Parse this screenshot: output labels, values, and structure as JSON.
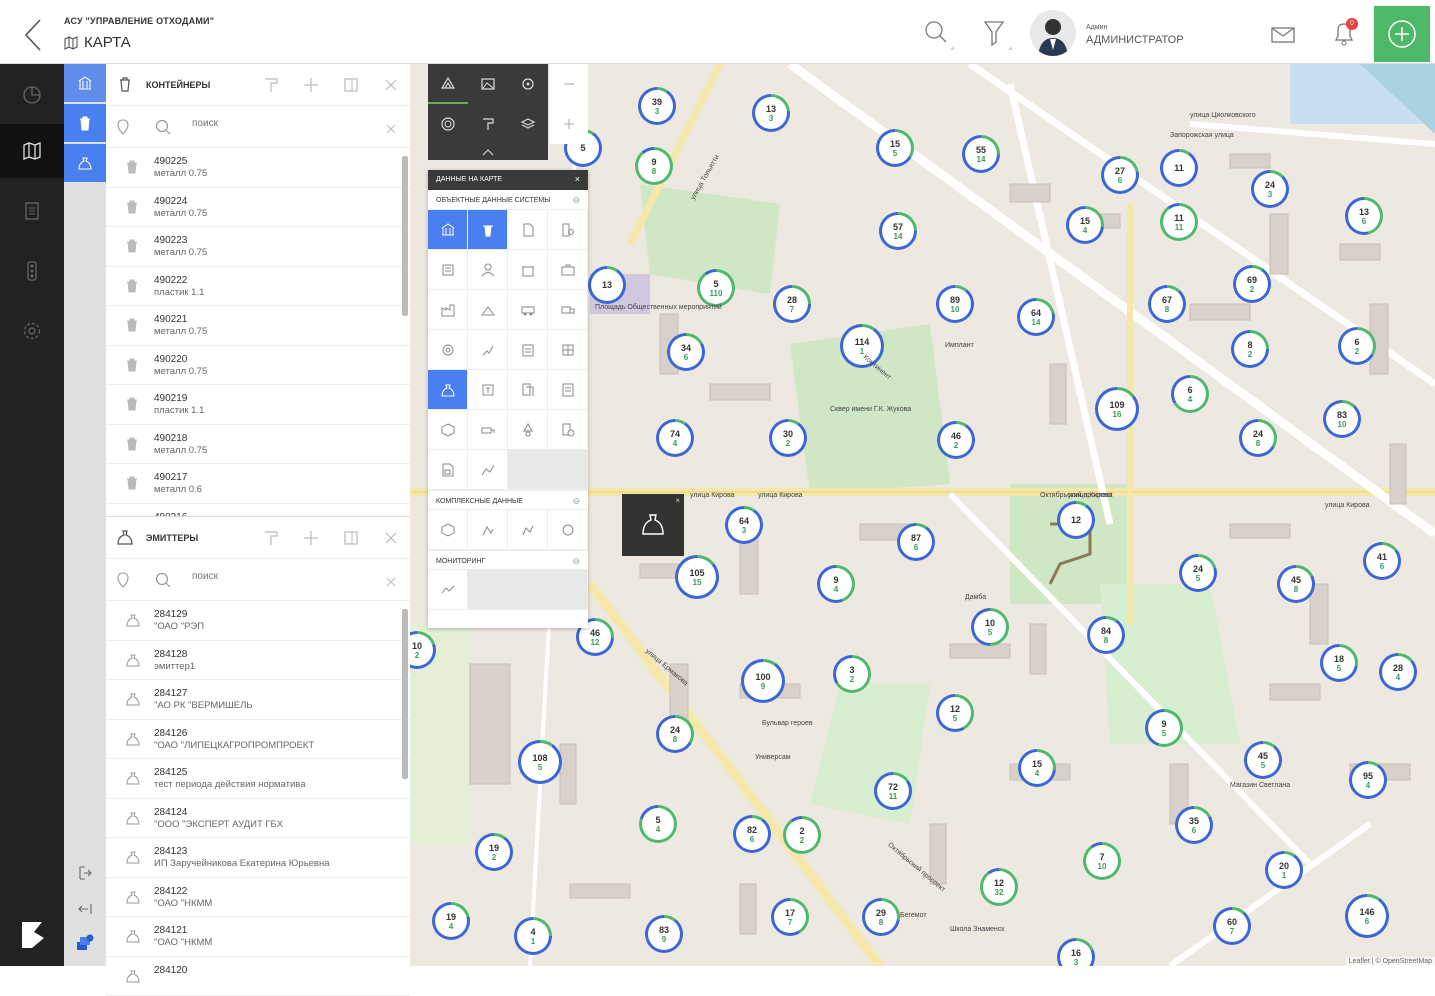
{
  "header": {
    "app_name": "АСУ \"УПРАВЛЕНИЕ ОТХОДАМИ\"",
    "page_title": "КАРТА",
    "user_small": "Админ",
    "user_role": "АДМИНИСТРАТОР",
    "notifications": "0"
  },
  "containers": {
    "title": "КОНТЕЙНЕРЫ",
    "search_placeholder": "поиск",
    "items": [
      {
        "id": "490225",
        "desc": "металл 0.75"
      },
      {
        "id": "490224",
        "desc": "металл 0.75"
      },
      {
        "id": "490223",
        "desc": "металл 0.75"
      },
      {
        "id": "490222",
        "desc": "пластик 1.1"
      },
      {
        "id": "490221",
        "desc": "металл 0.75"
      },
      {
        "id": "490220",
        "desc": "металл 0.75"
      },
      {
        "id": "490219",
        "desc": "пластик 1.1"
      },
      {
        "id": "490218",
        "desc": "металл 0.75"
      },
      {
        "id": "490217",
        "desc": "металл 0.6"
      },
      {
        "id": "490216",
        "desc": ""
      }
    ]
  },
  "emitters": {
    "title": "ЭМИТТЕРЫ",
    "search_placeholder": "поиск",
    "items": [
      {
        "id": "284129",
        "desc": "\"ОАО \"РЭП"
      },
      {
        "id": "284128",
        "desc": "эмиттер1"
      },
      {
        "id": "284127",
        "desc": "\"АО РК \"ВЕРМИШЕЛЬ"
      },
      {
        "id": "284126",
        "desc": "\"ОАО \"ЛИПЕЦКАГРОПРОМПРОЕКТ"
      },
      {
        "id": "284125",
        "desc": "тест периода действия норматива"
      },
      {
        "id": "284124",
        "desc": "\"ООО \"ЭКСПЕРТ АУДИТ ГБХ"
      },
      {
        "id": "284123",
        "desc": "ИП Заручейникова Екатерина Юрьевна"
      },
      {
        "id": "284122",
        "desc": "\"ОАО \"НКММ"
      },
      {
        "id": "284121",
        "desc": "\"ОАО \"НКММ"
      },
      {
        "id": "284120",
        "desc": ""
      }
    ]
  },
  "layers": {
    "title": "ДАННЫЕ НА КАРТЕ",
    "section_objects": "ОБЪЕКТНЫЕ ДАННЫЕ СИСТЕМЫ",
    "section_complex": "КОМПЛЕКСНЫЕ ДАННЫЕ",
    "section_monitoring": "МОНИТОРИНГ"
  },
  "map": {
    "labels": [
      "улица Тольятти",
      "Запорожская улица",
      "Площадь Общественных мероприятий",
      "Сквер имени Г.К. Жукова",
      "улица Кирова",
      "Октябрьский проспект",
      "улица Ермакова",
      "Континент",
      "Имплант",
      "Бульвар героев",
      "Универсам",
      "Магазин Светлана",
      "Беге­мот",
      "Школа Знаменск",
      "Дамба",
      "улица Циолковского",
      "улица Кирова",
      "улица Кирова",
      "улица Кирова",
      "Октябрьский проспект"
    ],
    "attribution": "Leaflet | © OpenStreetMap",
    "clusters": [
      {
        "a": "39",
        "b": "3"
      },
      {
        "a": "13",
        "b": "3"
      },
      {
        "a": "15",
        "b": "5"
      },
      {
        "a": "55",
        "b": "14"
      },
      {
        "a": "27",
        "b": "6"
      },
      {
        "a": "11",
        "b": ""
      },
      {
        "a": "24",
        "b": "3"
      },
      {
        "a": "13",
        "b": "6"
      },
      {
        "a": "9",
        "b": "8"
      },
      {
        "a": "5",
        "b": ""
      },
      {
        "a": "57",
        "b": "14"
      },
      {
        "a": "15",
        "b": "4"
      },
      {
        "a": "11",
        "b": "11"
      },
      {
        "a": "13",
        "b": ""
      },
      {
        "a": "5",
        "b": "110"
      },
      {
        "a": "28",
        "b": "7"
      },
      {
        "a": "89",
        "b": "10"
      },
      {
        "a": "64",
        "b": "14"
      },
      {
        "a": "67",
        "b": "8"
      },
      {
        "a": "69",
        "b": "2"
      },
      {
        "a": "34",
        "b": "6"
      },
      {
        "a": "114",
        "b": "1"
      },
      {
        "a": "8",
        "b": "2"
      },
      {
        "a": "6",
        "b": "2"
      },
      {
        "a": "6",
        "b": "4"
      },
      {
        "a": "109",
        "b": "16"
      },
      {
        "a": "83",
        "b": "10"
      },
      {
        "a": "74",
        "b": "4"
      },
      {
        "a": "30",
        "b": "2"
      },
      {
        "a": "46",
        "b": "2"
      },
      {
        "a": "24",
        "b": "8"
      },
      {
        "a": "64",
        "b": "3"
      },
      {
        "a": "87",
        "b": "6"
      },
      {
        "a": "12",
        "b": ""
      },
      {
        "a": "105",
        "b": "15"
      },
      {
        "a": "9",
        "b": "4"
      },
      {
        "a": "24",
        "b": "5"
      },
      {
        "a": "45",
        "b": "8"
      },
      {
        "a": "41",
        "b": "6"
      },
      {
        "a": "46",
        "b": "12"
      },
      {
        "a": "10",
        "b": "5"
      },
      {
        "a": "84",
        "b": "8"
      },
      {
        "a": "10",
        "b": "2"
      },
      {
        "a": "100",
        "b": "9"
      },
      {
        "a": "3",
        "b": "2"
      },
      {
        "a": "18",
        "b": "5"
      },
      {
        "a": "28",
        "b": "4"
      },
      {
        "a": "12",
        "b": "5"
      },
      {
        "a": "24",
        "b": "8"
      },
      {
        "a": "9",
        "b": "5"
      },
      {
        "a": "108",
        "b": "5"
      },
      {
        "a": "15",
        "b": "4"
      },
      {
        "a": "45",
        "b": "5"
      },
      {
        "a": "72",
        "b": "11"
      },
      {
        "a": "95",
        "b": "4"
      },
      {
        "a": "5",
        "b": "4"
      },
      {
        "a": "82",
        "b": "6"
      },
      {
        "a": "2",
        "b": "2"
      },
      {
        "a": "35",
        "b": "6"
      },
      {
        "a": "19",
        "b": "2"
      },
      {
        "a": "7",
        "b": "10"
      },
      {
        "a": "20",
        "b": "1"
      },
      {
        "a": "12",
        "b": "32"
      },
      {
        "a": "19",
        "b": "4"
      },
      {
        "a": "4",
        "b": "1"
      },
      {
        "a": "83",
        "b": "9"
      },
      {
        "a": "17",
        "b": "7"
      },
      {
        "a": "29",
        "b": "8"
      },
      {
        "a": "60",
        "b": "7"
      },
      {
        "a": "146",
        "b": "6"
      },
      {
        "a": "16",
        "b": "3"
      }
    ]
  }
}
